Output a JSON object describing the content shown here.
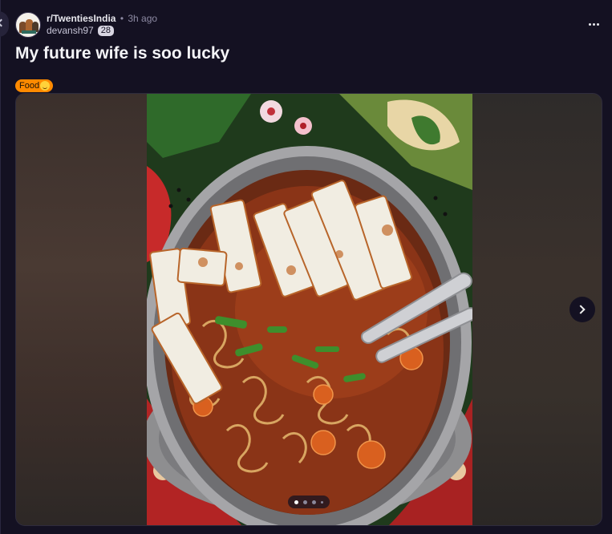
{
  "post": {
    "subreddit": "r/TwentiesIndia",
    "separator": "•",
    "time_ago": "3h ago",
    "username": "devansh97",
    "karma_badge": "28",
    "title": "My future wife is soo lucky",
    "flair_text": "Food",
    "flair_emoji_icon": "smiling-face-icon",
    "flair_color": "#ff8a00"
  },
  "media": {
    "current_slide": 1,
    "total_slides": 4,
    "next_icon": "chevron-right-icon"
  },
  "colors": {
    "background": "#141122",
    "badge": "#d8d6e2"
  },
  "icons": {
    "more": "more-options-icon",
    "back": "chevron-left-icon"
  }
}
